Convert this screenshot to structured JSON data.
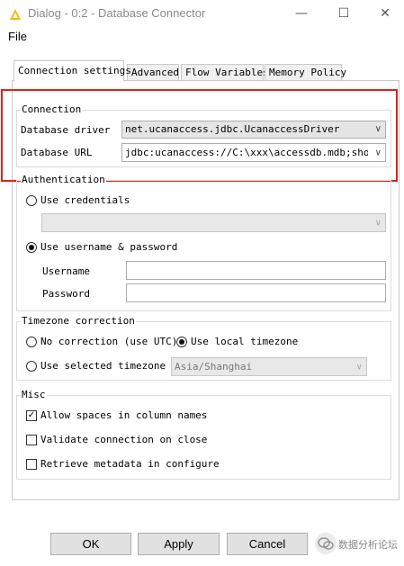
{
  "window": {
    "title": "Dialog - 0:2 - Database Connector",
    "minimize": "—",
    "maximize": "☐",
    "close": "✕"
  },
  "menu": {
    "file": "File"
  },
  "tabs": [
    {
      "label": "Connection settings",
      "active": true
    },
    {
      "label": "Advanced",
      "active": false
    },
    {
      "label": "Flow Variables",
      "active": false
    },
    {
      "label": "Memory Policy",
      "active": false
    }
  ],
  "connection": {
    "title": "Connection",
    "driver_label": "Database driver",
    "driver_value": "net.ucanaccess.jdbc.UcanaccessDriver",
    "url_label": "Database URL",
    "url_value": "jdbc:ucanaccess://C:\\xxx\\accessdb.mdb;showSch"
  },
  "authentication": {
    "title": "Authentication",
    "use_credentials": "Use credentials",
    "credentials_value": "",
    "use_username_password": "Use username & password",
    "selected": "use_username_password",
    "username_label": "Username",
    "username_value": "",
    "password_label": "Password",
    "password_value": ""
  },
  "timezone": {
    "title": "Timezone correction",
    "no_correction": "No correction (use UTC)",
    "use_local": "Use local timezone",
    "use_selected": "Use selected timezone",
    "selected_timezone": "Asia/Shanghai",
    "selected": "use_local"
  },
  "misc": {
    "title": "Misc",
    "allow_spaces": "Allow spaces in column names",
    "allow_spaces_checked": true,
    "validate_connection": "Validate connection on close",
    "validate_connection_checked": false,
    "retrieve_metadata": "Retrieve metadata in configure",
    "retrieve_metadata_checked": false
  },
  "buttons": {
    "ok": "OK",
    "apply": "Apply",
    "cancel": "Cancel"
  },
  "watermark": {
    "text": "数据分析论坛"
  },
  "colors": {
    "highlight_box": "#d9251c",
    "title_icon": "#f5b800"
  }
}
